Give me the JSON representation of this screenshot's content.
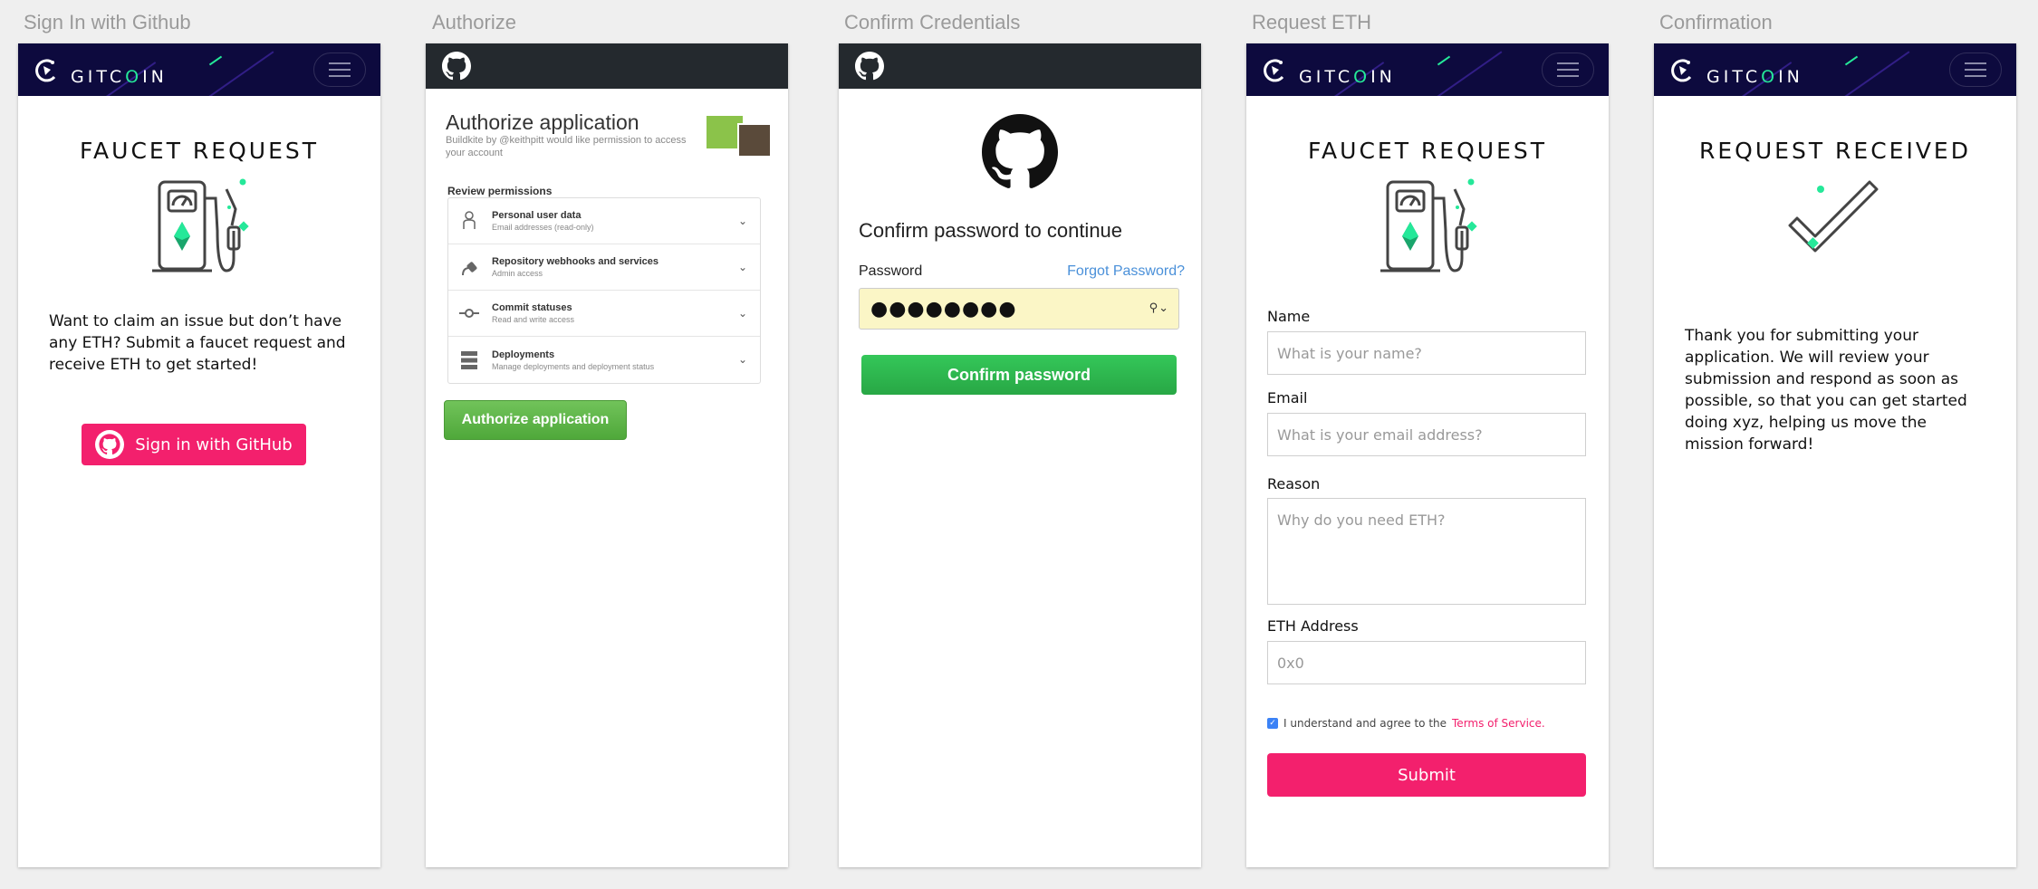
{
  "screens": [
    {
      "label": "Sign In with Github"
    },
    {
      "label": "Authorize"
    },
    {
      "label": "Confirm Credentials"
    },
    {
      "label": "Request ETH"
    },
    {
      "label": "Confirmation"
    }
  ],
  "gitcoin": {
    "logo_word_pre": "GITC",
    "logo_word_o": "O",
    "logo_word_post": "IN",
    "accent": "#25e899",
    "header_bg": "#0d0a3e",
    "brand_pink": "#f3206d"
  },
  "signin": {
    "title": "FAUCET REQUEST",
    "body": "Want to claim an issue but don’t have any ETH? Submit a faucet request and receive ETH to get started!",
    "button_label": "Sign in with GitHub",
    "icon": "github-icon"
  },
  "authorize": {
    "title": "Authorize application",
    "subtitle": "Buildkite by @keithpitt would like permission to access your account",
    "review_label": "Review permissions",
    "permissions": [
      {
        "name": "Personal user data",
        "desc": "Email addresses (read-only)",
        "icon": "person-icon"
      },
      {
        "name": "Repository webhooks and services",
        "desc": "Admin access",
        "icon": "plug-icon"
      },
      {
        "name": "Commit statuses",
        "desc": "Read and write access",
        "icon": "commit-icon"
      },
      {
        "name": "Deployments",
        "desc": "Manage deployments and deployment status",
        "icon": "server-icon"
      }
    ],
    "button_label": "Authorize application"
  },
  "confirm": {
    "heading": "Confirm password to continue",
    "password_label": "Password",
    "forgot_label": "Forgot Password?",
    "password_value": "●●●●●●●●",
    "button_label": "Confirm password"
  },
  "request": {
    "title": "FAUCET REQUEST",
    "name_label": "Name",
    "name_placeholder": "What is your name?",
    "email_label": "Email",
    "email_placeholder": "What is your email address?",
    "reason_label": "Reason",
    "reason_placeholder": "Why do you need ETH?",
    "address_label": "ETH Address",
    "address_placeholder": "0x0",
    "tos_text": "I understand and agree to the",
    "tos_link": "Terms of Service.",
    "submit_label": "Submit"
  },
  "confirmation": {
    "title": "REQUEST RECEIVED",
    "body": "Thank you for submitting your application. We will review your submission and respond as soon as possible, so that you can get started doing xyz, helping us move the mission forward!"
  }
}
